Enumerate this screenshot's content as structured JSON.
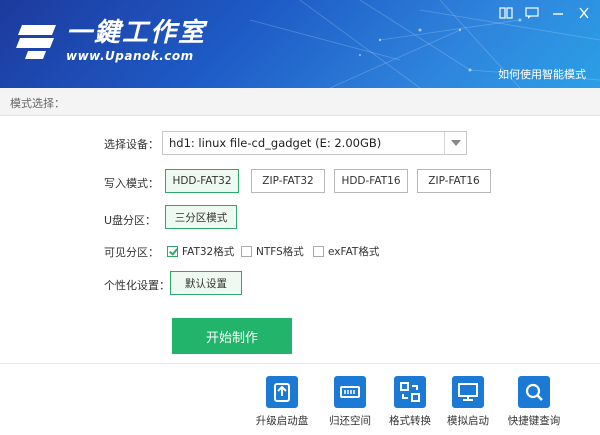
{
  "header": {
    "brand": "一鍵工作室",
    "site": "www.Upanok.com",
    "help_link": "如何使用智能模式"
  },
  "mode_bar": {
    "label": "模式选择："
  },
  "device": {
    "label": "选择设备：",
    "selected": "hd1: linux file-cd_gadget  (E: 2.00GB)"
  },
  "write_mode": {
    "label": "写入模式：",
    "options": [
      "HDD-FAT32",
      "ZIP-FAT32",
      "HDD-FAT16",
      "ZIP-FAT16"
    ],
    "selected": "HDD-FAT32"
  },
  "partition": {
    "label": "U盘分区：",
    "value": "三分区模式"
  },
  "visible_partition": {
    "label": "可见分区：",
    "options": [
      {
        "label": "FAT32格式",
        "checked": true
      },
      {
        "label": "NTFS格式",
        "checked": false
      },
      {
        "label": "exFAT格式",
        "checked": false
      }
    ]
  },
  "personalize": {
    "label": "个性化设置：",
    "button": "默认设置"
  },
  "start_button": "开始制作",
  "tools": [
    {
      "label": "升级启动盘",
      "icon": "upgrade-disk-icon"
    },
    {
      "label": "归还空间",
      "icon": "restore-space-icon"
    },
    {
      "label": "格式转换",
      "icon": "format-convert-icon"
    },
    {
      "label": "模拟启动",
      "icon": "monitor-icon"
    },
    {
      "label": "快捷键查询",
      "icon": "search-icon"
    }
  ],
  "colors": {
    "header": "#1e5bc6",
    "accent": "#22b46b",
    "tool_icon": "#1a7ad4"
  }
}
